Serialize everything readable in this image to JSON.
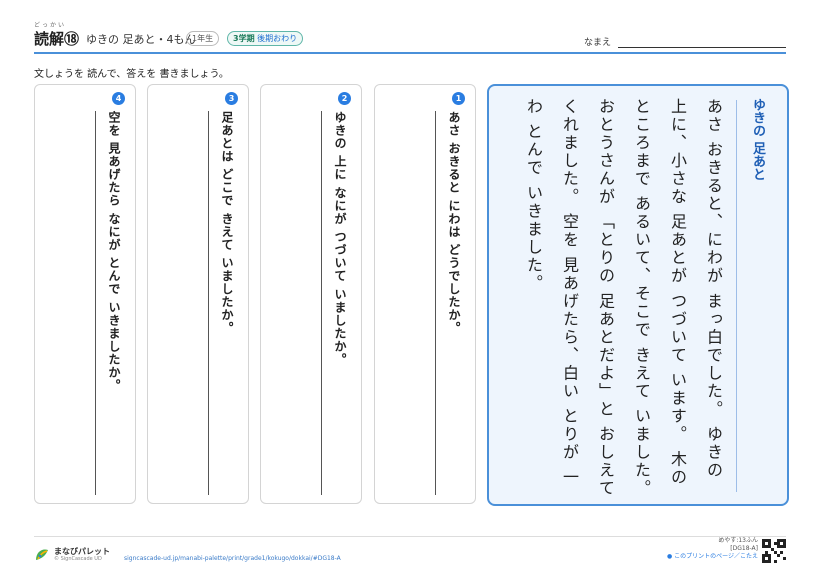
{
  "header": {
    "title": "読解⑱",
    "title_ruby": "どっかい",
    "subtitle": "ゆきの 足あと・4もん",
    "grade_badge": "1年生",
    "term_badge_main": "3学期",
    "term_badge_sub": "後期おわり",
    "name_label": "なまえ"
  },
  "instruction": "文しょうを 読んで、答えを 書きましょう。",
  "questions": [
    {
      "number": "1",
      "text": "あさ おきると にわは どうでしたか。"
    },
    {
      "number": "2",
      "text": "ゆきの 上に なにが つづいて いましたか。"
    },
    {
      "number": "3",
      "text": "足あとは どこで きえて いましたか。"
    },
    {
      "number": "4",
      "text": "空を 見あげたら なにが とんで いきましたか。"
    }
  ],
  "story": {
    "title": "ゆきの 足あと",
    "body": "あさ おきると、にわが まっ白でした。 ゆきの 上に、小さな 足あとが つづいて います。 木の ところまで あるいて、そこで きえて いました。 おとうさんが 「とりの 足あとだよ」と おしえて くれました。 空を 見あげたら、白い とりが 一わ とんで いきました。"
  },
  "footer": {
    "logo_name": "まなびパレット",
    "logo_copy": "© SignCascade UD",
    "url": "signcascade-ud.jp/manabi-palette/print/grade1/kokugo/dokkai/#DG18-A",
    "estimate": "めやす:13ふん",
    "code": "[DG18-A]",
    "link": "● このプリントのページ／こたえ"
  },
  "colors": {
    "accent": "#2a7de1",
    "story_border": "#4a90d9",
    "story_bg": "#eef5fd"
  }
}
